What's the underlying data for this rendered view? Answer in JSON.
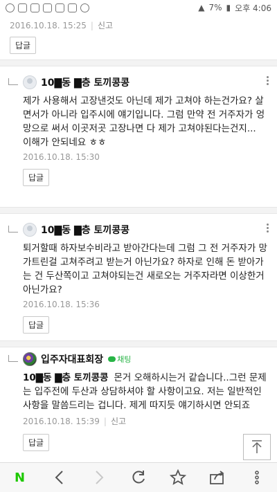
{
  "status_bar": {
    "battery_percent": "7%",
    "time": "오후 4:06"
  },
  "top_comment": {
    "date": "2016.10.18. 15:25",
    "report": "신고",
    "reply": "답글"
  },
  "comments": [
    {
      "author": "10▇동 ▇층 토끼콩콩",
      "text": "제가 사용해서 고장낸것도 아닌데 제가 고쳐야 하는건가요? 살면서가 아니라 입주시에 얘기입니다. 그럼 만약 전 거주자가 엉망으로 써서 이곳저곳 고장나면 다 제가 고쳐야된다는건지...\n이해가 안되네요 ㅎㅎ",
      "date": "2016.10.18. 15:30",
      "reply": "답글"
    },
    {
      "author": "10▇동 ▇층 토끼콩콩",
      "text": "퇴거할때 하자보수비라고 받아간다는데 그럼 그 전 거주자가 망가트린걸 고쳐주려고 받는거 아닌가요? 하자로 인해 돈 받아가는 건 두산쪽이고 고쳐야되는건 새로오는 거주자라면 이상한거 아닌가요?",
      "date": "2016.10.18. 15:36",
      "reply": "답글"
    },
    {
      "author": "입주자대표회장",
      "badge": "채팅",
      "mention": "10▇동 ▇층 토끼콩콩",
      "text": "몬거 오해하시는거 같습니다..그런 문제는 입주전에 두산과 상담하셔야 할 사항이고요. 저는 일반적인 사항을 말씀드리는 겁니다. 제게 따지듯 얘기하시면 안되죠",
      "date": "2016.10.18. 15:39",
      "report": "신고",
      "reply": "답글"
    }
  ],
  "bottom_nav": {
    "logo": "N",
    "icons": [
      "back-icon",
      "forward-icon",
      "refresh-icon",
      "star-icon",
      "share-icon",
      "more-icon"
    ]
  },
  "colors": {
    "naver_green": "#1ec800",
    "chat_green": "#28b446"
  }
}
